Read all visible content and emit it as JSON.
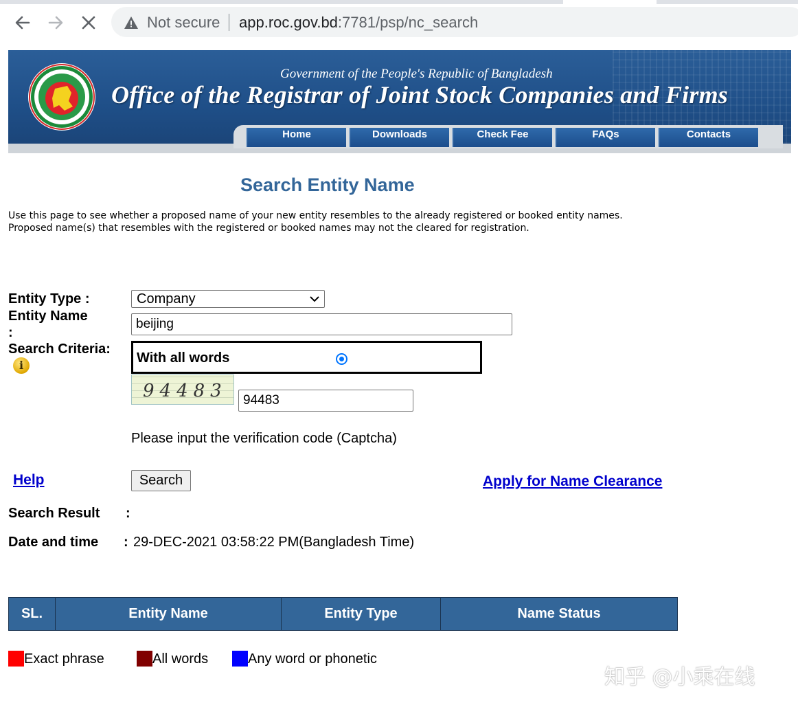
{
  "browser": {
    "security_label": "Not secure",
    "url_host": "app.roc.gov.bd",
    "url_rest": ":7781/psp/nc_search"
  },
  "banner": {
    "government": "Government of the People's Republic of Bangladesh",
    "office": "Office of the Registrar of Joint Stock Companies and Firms",
    "menu": [
      "Home",
      "Downloads",
      "Check Fee",
      "FAQs",
      "Contacts"
    ]
  },
  "page": {
    "title": "Search Entity Name",
    "intro_line1": "Use this page to see whether a proposed name of your new entity resembles to the already registered or booked entity names.",
    "intro_line2": "Proposed name(s) that resembles with the registered or booked names may not the cleared for registration."
  },
  "form": {
    "entity_type_label": "Entity Type :",
    "entity_type_value": "Company",
    "entity_name_label": "Entity Name",
    "entity_name_colon": ":",
    "entity_name_value": "beijing",
    "criteria_label": "Search Criteria:",
    "criteria_option": "With all words",
    "info_glyph": "i",
    "captcha_image_text": "94483",
    "captcha_value": "94483",
    "captcha_hint": "Please input the verification code (Captcha)",
    "help_link": "Help",
    "search_button": "Search",
    "apply_link": "Apply for Name Clearance"
  },
  "result": {
    "search_result_label": "Search Result",
    "date_label": "Date and time",
    "colon": ":",
    "date_value": "29-DEC-2021 03:58:22 PM(Bangladesh Time)"
  },
  "table": {
    "headers": [
      "SL.",
      "Entity Name",
      "Entity Type",
      "Name Status"
    ]
  },
  "legend": [
    {
      "label": "Exact phrase",
      "color": "#ff0000"
    },
    {
      "label": "All words",
      "color": "#800000"
    },
    {
      "label": "Any word or phonetic",
      "color": "#0000ff"
    }
  ],
  "watermark": "知乎 @小乘在线"
}
